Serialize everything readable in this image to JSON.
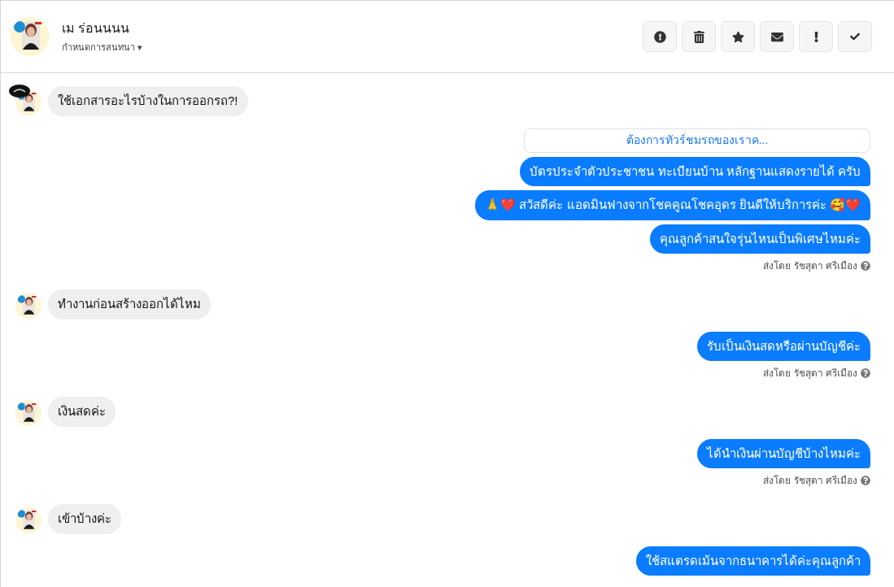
{
  "header": {
    "name": "เม ร่อนนนน",
    "subtitle": "กำหนดการสนทนา ▾"
  },
  "toolbar": [
    {
      "kind": "alert"
    },
    {
      "kind": "trash"
    },
    {
      "kind": "star"
    },
    {
      "kind": "mail"
    },
    {
      "kind": "exclaim"
    },
    {
      "kind": "check"
    }
  ],
  "messages": [
    {
      "kind": "incoming",
      "text": "ใช้เอกสารอะไรบ้างในการออกรถ?!",
      "badge": true
    },
    {
      "kind": "card",
      "text": "ต้องการทัวร์ชมรถของเราค..."
    },
    {
      "kind": "outgoing",
      "text": "บัตรประจำตัวประชาชน ทะเบียนบ้าน หลักฐานแสดงรายได้ ครับ"
    },
    {
      "kind": "outgoing",
      "text": "🙏❤️ สวัสดีค่ะ แอดมินฟางจากโชคคูณโชคอุดร ยินดีให้บริการค่ะ  🥰❤️"
    },
    {
      "kind": "outgoing",
      "text": "คุณลูกค้าสนใจรุ่นไหนเป็นพิเศษไหมค่ะ"
    },
    {
      "kind": "sent_by",
      "text": "ส่งโดย รัชสุดา ศรีเมือง"
    },
    {
      "kind": "incoming",
      "text": "ทำงานก่อนสร้างออกได้ไหม",
      "badge": false
    },
    {
      "kind": "outgoing",
      "text": "รับเป็นเงินสดหรือผ่านบัญชีค่ะ"
    },
    {
      "kind": "sent_by",
      "text": "ส่งโดย รัชสุดา ศรีเมือง"
    },
    {
      "kind": "incoming",
      "text": "เงินสดค่ะ",
      "badge": false
    },
    {
      "kind": "outgoing",
      "text": "ได้นำเงินผ่านบัญชีบ้างไหมค่ะ"
    },
    {
      "kind": "sent_by",
      "text": "ส่งโดย รัชสุดา ศรีเมือง"
    },
    {
      "kind": "incoming",
      "text": "เข้าบ้างค่ะ",
      "badge": false
    },
    {
      "kind": "outgoing",
      "text": "ใช้สแตรดเม้นจากธนาคารได้ค่ะคุณลูกค้า"
    }
  ]
}
